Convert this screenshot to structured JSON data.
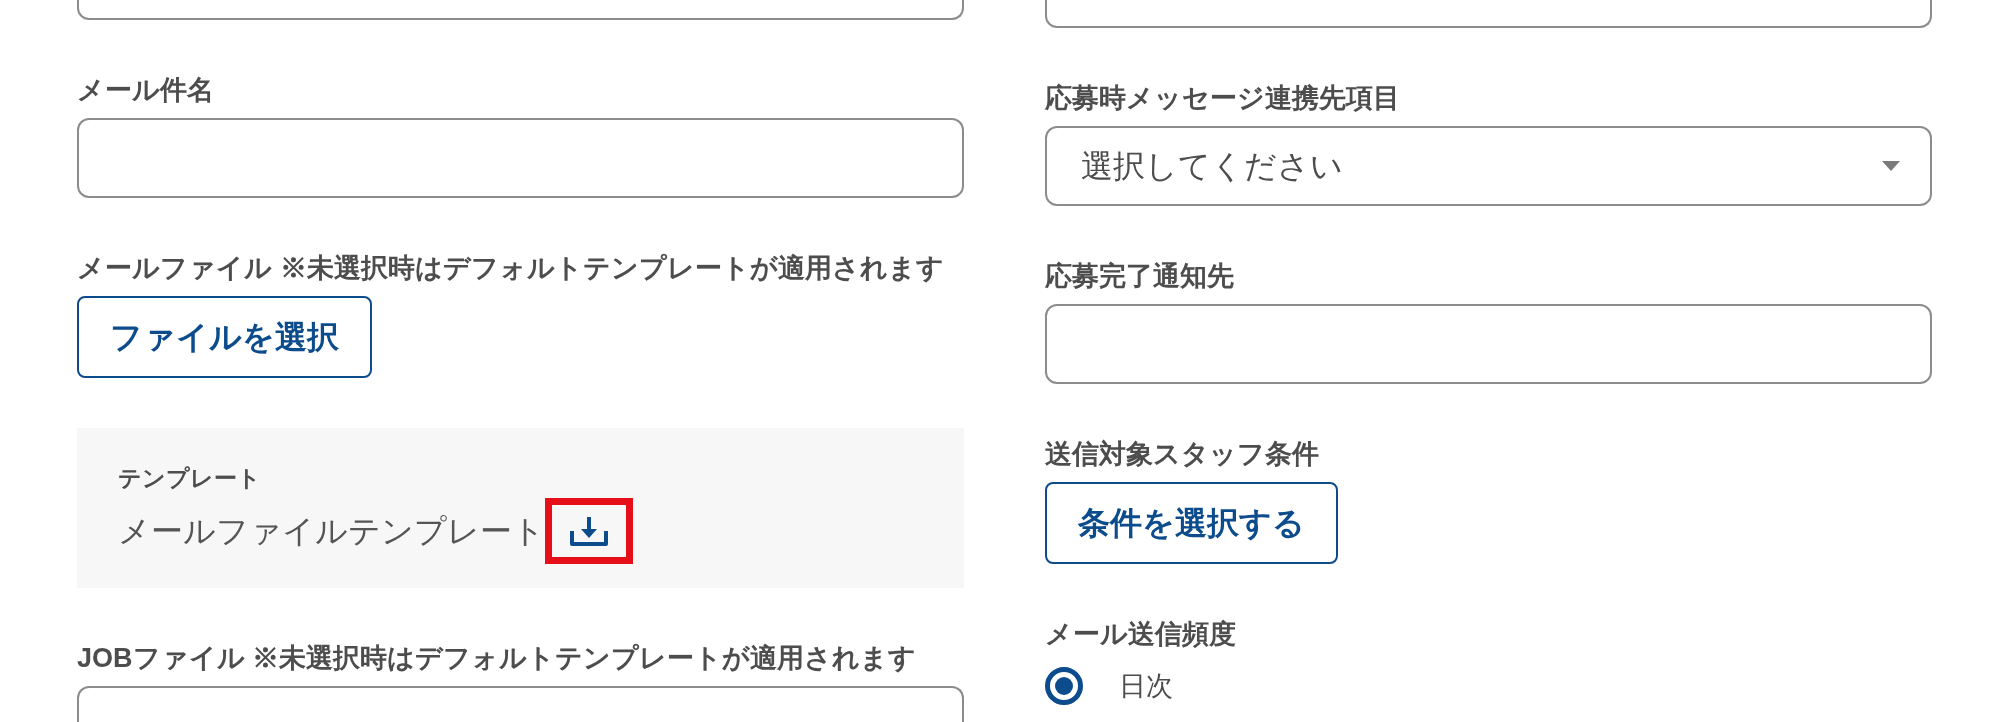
{
  "left_column": [
    {
      "kind": "box"
    },
    {
      "kind": "text_input",
      "label": "メール件名"
    },
    {
      "kind": "button",
      "label": "メールファイル ※未選択時はデフォルトテンプレートが適用されます",
      "button": "ファイルを選択"
    },
    {
      "kind": "template_panel",
      "label": "テンプレート",
      "file": "メールファイルテンプレート",
      "highlighted": true
    },
    {
      "kind": "box",
      "label": "JOBファイル ※未選択時はデフォルトテンプレートが適用されます"
    }
  ],
  "right_column": [
    {
      "kind": "box"
    },
    {
      "kind": "select",
      "label": "応募時メッセージ連携先項目",
      "value": "選択してください"
    },
    {
      "kind": "text_input",
      "label": "応募完了通知先"
    },
    {
      "kind": "button",
      "label": "送信対象スタッフ条件",
      "button": "条件を選択する"
    },
    {
      "kind": "radio_group",
      "label": "メール送信頻度",
      "options": [
        {
          "label": "日次",
          "selected": true
        }
      ]
    }
  ]
}
